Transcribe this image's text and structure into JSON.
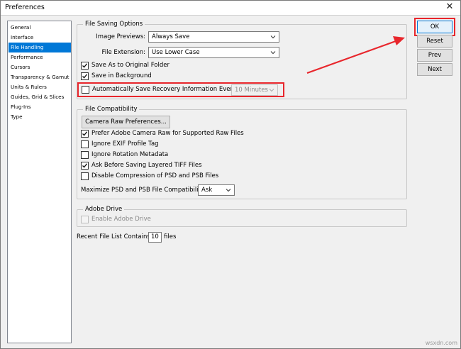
{
  "window": {
    "title": "Preferences"
  },
  "sidebar": {
    "items": [
      {
        "label": "General"
      },
      {
        "label": "Interface"
      },
      {
        "label": "File Handling",
        "selected": true
      },
      {
        "label": "Performance"
      },
      {
        "label": "Cursors"
      },
      {
        "label": "Transparency & Gamut"
      },
      {
        "label": "Units & Rulers"
      },
      {
        "label": "Guides, Grid & Slices"
      },
      {
        "label": "Plug-Ins"
      },
      {
        "label": "Type"
      }
    ]
  },
  "file_saving": {
    "title": "File Saving Options",
    "image_previews_label": "Image Previews:",
    "image_previews_value": "Always Save",
    "file_extension_label": "File Extension:",
    "file_extension_value": "Use Lower Case",
    "save_as_original": {
      "label": "Save As to Original Folder",
      "checked": true
    },
    "save_in_background": {
      "label": "Save in Background",
      "checked": true
    },
    "auto_save": {
      "label": "Automatically Save Recovery Information Every:",
      "checked": false
    },
    "auto_save_interval": "10 Minutes"
  },
  "file_compat": {
    "title": "File Compatibility",
    "camera_raw_button": "Camera Raw Preferences...",
    "prefer_acr": {
      "label": "Prefer Adobe Camera Raw for Supported Raw Files",
      "checked": true
    },
    "ignore_exif": {
      "label": "Ignore EXIF Profile Tag",
      "checked": false
    },
    "ignore_rotation": {
      "label": "Ignore Rotation Metadata",
      "checked": false
    },
    "ask_tiff": {
      "label": "Ask Before Saving Layered TIFF Files",
      "checked": true
    },
    "disable_compression": {
      "label": "Disable Compression of PSD and PSB Files",
      "checked": false
    },
    "maximize_label": "Maximize PSD and PSB File Compatibility:",
    "maximize_value": "Ask"
  },
  "adobe_drive": {
    "title": "Adobe Drive",
    "enable": {
      "label": "Enable Adobe Drive",
      "checked": false
    }
  },
  "recent_files": {
    "label": "Recent File List Contains:",
    "value": "10",
    "suffix": "files"
  },
  "buttons": {
    "ok": "OK",
    "reset": "Reset",
    "prev": "Prev",
    "next": "Next"
  },
  "watermark": "wsxdn.com",
  "colors": {
    "highlight": "#e8262c",
    "selection": "#0078d7"
  }
}
